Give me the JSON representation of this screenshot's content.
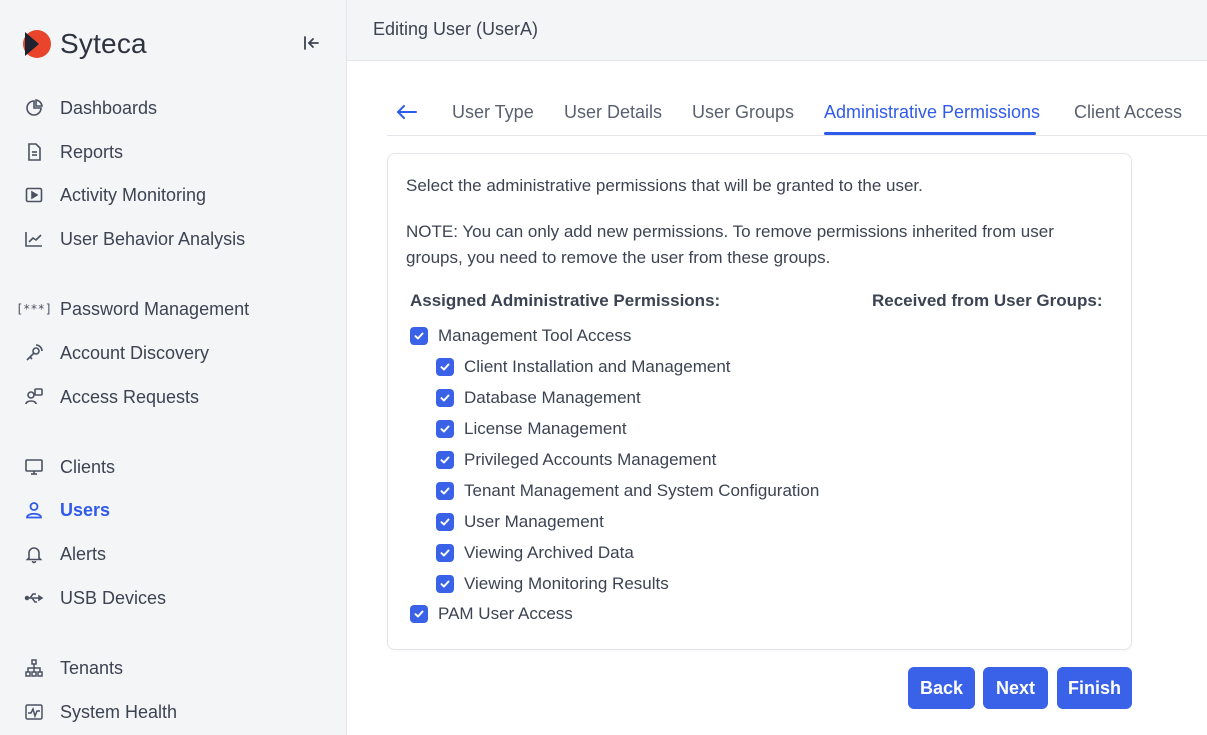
{
  "brand": {
    "name": "Syteca",
    "logo_color": "#e8452c"
  },
  "sidebar": {
    "items": [
      {
        "label": "Dashboards",
        "icon": "pie-chart-icon"
      },
      {
        "label": "Reports",
        "icon": "document-icon"
      },
      {
        "label": "Activity Monitoring",
        "icon": "play-square-icon"
      },
      {
        "label": "User Behavior Analysis",
        "icon": "trend-chart-icon"
      },
      {
        "label": "Password Management",
        "icon": "password-icon"
      },
      {
        "label": "Account Discovery",
        "icon": "radar-icon"
      },
      {
        "label": "Access Requests",
        "icon": "user-question-icon"
      },
      {
        "label": "Clients",
        "icon": "monitor-icon"
      },
      {
        "label": "Users",
        "icon": "user-icon",
        "active": true
      },
      {
        "label": "Alerts",
        "icon": "bell-icon"
      },
      {
        "label": "USB Devices",
        "icon": "usb-icon"
      },
      {
        "label": "Tenants",
        "icon": "hierarchy-icon"
      },
      {
        "label": "System Health",
        "icon": "pulse-icon"
      }
    ]
  },
  "header": {
    "title": "Editing User (UserA)"
  },
  "tabs": [
    {
      "label": "User Type"
    },
    {
      "label": "User Details"
    },
    {
      "label": "User Groups"
    },
    {
      "label": "Administrative Permissions",
      "active": true
    },
    {
      "label": "Client Access"
    }
  ],
  "panel": {
    "intro": "Select the administrative permissions that will be granted to the user.",
    "note": "NOTE: You can only add new permissions. To remove permissions inherited from user groups, you need to remove the user from these groups.",
    "assigned_header": "Assigned Administrative Permissions:",
    "received_header": "Received from User Groups:",
    "permissions": [
      {
        "label": "Management Tool Access",
        "checked": true
      },
      {
        "label": "Client Installation and Management",
        "checked": true
      },
      {
        "label": "Database Management",
        "checked": true
      },
      {
        "label": "License Management",
        "checked": true
      },
      {
        "label": "Privileged Accounts Management",
        "checked": true
      },
      {
        "label": "Tenant Management and System Configuration",
        "checked": true
      },
      {
        "label": "User Management",
        "checked": true
      },
      {
        "label": "Viewing Archived Data",
        "checked": true
      },
      {
        "label": "Viewing Monitoring Results",
        "checked": true
      },
      {
        "label": "PAM User Access",
        "checked": true
      }
    ]
  },
  "buttons": {
    "back": "Back",
    "next": "Next",
    "finish": "Finish"
  },
  "colors": {
    "accent": "#2f5bea",
    "checkbox": "#3a62e8",
    "sidebar_bg": "#f4f5f7"
  }
}
